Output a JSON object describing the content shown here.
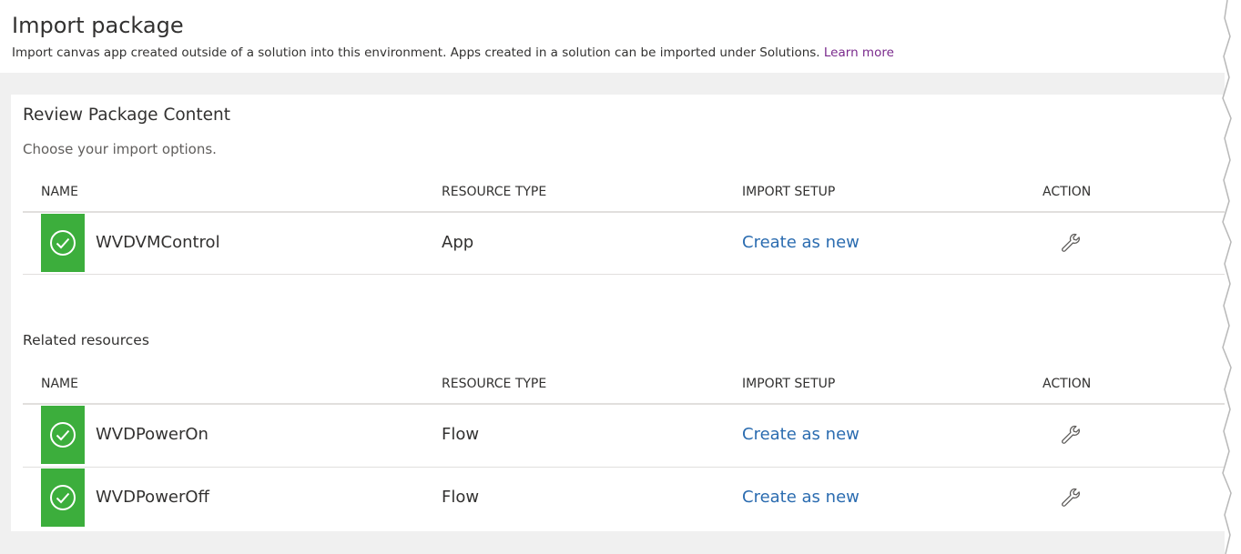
{
  "header": {
    "title": "Import package",
    "description": "Import canvas app created outside of a solution into this environment. Apps created in a solution can be imported under Solutions.",
    "learn_more": "Learn more"
  },
  "review": {
    "title": "Review Package Content",
    "subtitle": "Choose your import options.",
    "columns": {
      "name": "NAME",
      "resource_type": "RESOURCE TYPE",
      "import_setup": "IMPORT SETUP",
      "action": "ACTION"
    },
    "rows": [
      {
        "name": "WVDVMControl",
        "resource_type": "App",
        "import_setup": "Create as new"
      }
    ]
  },
  "related": {
    "title": "Related resources",
    "columns": {
      "name": "NAME",
      "resource_type": "RESOURCE TYPE",
      "import_setup": "IMPORT SETUP",
      "action": "ACTION"
    },
    "rows": [
      {
        "name": "WVDPowerOn",
        "resource_type": "Flow",
        "import_setup": "Create as new"
      },
      {
        "name": "WVDPowerOff",
        "resource_type": "Flow",
        "import_setup": "Create as new"
      }
    ]
  },
  "icons": {
    "status": "check-circle-icon",
    "action": "wrench-icon"
  },
  "colors": {
    "status_green": "#3cae3c",
    "link_blue": "#2b6cb0",
    "learn_more_purple": "#7a2a8c",
    "band_gray": "#f0f0f0"
  }
}
